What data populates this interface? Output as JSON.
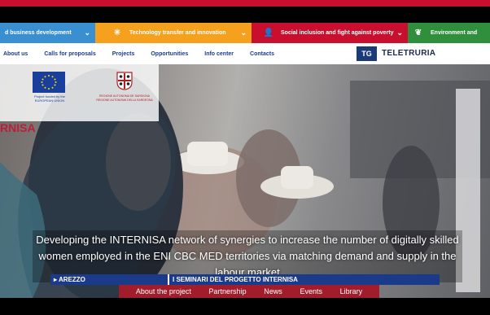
{
  "topics": [
    {
      "label": "d business development",
      "color": "#3a8fd0",
      "icon": "chevron-down-icon"
    },
    {
      "label": "Technology transfer and innovation",
      "color": "#f5a11d",
      "icon": "sun-icon"
    },
    {
      "label": "Social inclusion and fight against poverty",
      "color": "#c8102e",
      "icon": "person-icon"
    },
    {
      "label": "Environment and",
      "color": "#2f8f3c",
      "icon": "leaf-icon"
    }
  ],
  "nav": {
    "links": [
      "About us",
      "Calls for proposals",
      "Projects",
      "Opportunities",
      "Info center",
      "Contacts"
    ]
  },
  "tv": {
    "logo": "TG",
    "name": "TELETRURIA"
  },
  "logos": {
    "eu_caption": "Project funded by the EUROPEAN UNION",
    "sardinia_caption": "REGIONE AUTONOMA DE SARDIGNA REGIONE AUTONOMA DELLA SARDEGNA"
  },
  "hero": {
    "brand_fragment": "RNISA",
    "subtitle": "Developing the INTERNISA network of synergies to increase the number of digitally skilled women employed in the ENI CBC MED territories via matching demand and supply in the labour market"
  },
  "ticker": {
    "location": "▸ AREZZO",
    "text": "I SEMINARI DEL PROGETTO INTERNISA"
  },
  "subnav": {
    "items": [
      "About the project",
      "Partnership",
      "News",
      "Events",
      "Library"
    ]
  }
}
